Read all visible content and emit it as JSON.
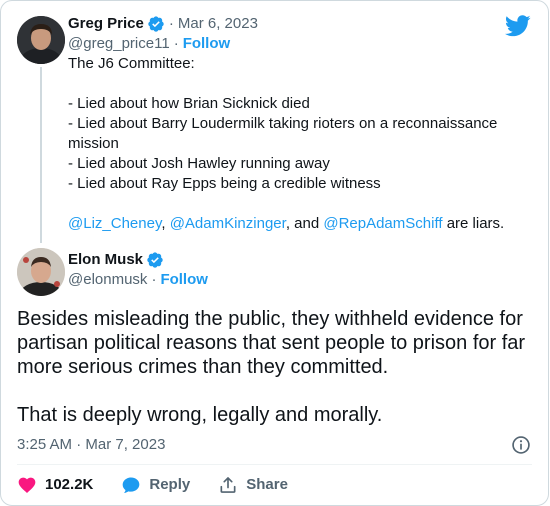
{
  "quoted_tweet": {
    "author_name": "Greg Price",
    "handle": "@greg_price11",
    "date": "Mar 6, 2023",
    "follow_label": "Follow",
    "lines": [
      "The J6 Committee:",
      "",
      "- Lied about how Brian Sicknick died",
      "- Lied about Barry Loudermilk taking rioters on a reconnaissance",
      "mission",
      "- Lied about Josh Hawley running away",
      "- Lied about Ray Epps being a credible witness",
      ""
    ],
    "mentions_line": {
      "mention_1": "@Liz_Cheney",
      "sep_1": ", ",
      "mention_2": "@AdamKinzinger",
      "sep_2": ", and ",
      "mention_3": "@RepAdamSchiff",
      "tail": " are liars."
    }
  },
  "main_tweet": {
    "author_name": "Elon Musk",
    "handle": "@elonmusk",
    "follow_label": "Follow",
    "paragraph_1": "Besides misleading the public, they withheld evidence for partisan political reasons that sent people to prison for far more serious crimes than they committed.",
    "paragraph_2": "That is deeply wrong, legally and morally.",
    "timestamp": "3:25 AM · Mar 7, 2023"
  },
  "actions": {
    "like_count": "102.2K",
    "reply_label": "Reply",
    "share_label": "Share"
  },
  "icons": {
    "twitter_logo": "twitter-bird-icon",
    "verified": "verified-badge-icon",
    "info": "info-icon",
    "like": "heart-icon",
    "reply": "chat-bubble-icon",
    "share": "share-icon"
  },
  "colors": {
    "accent": "#1d9bf0",
    "like": "#f91880",
    "text": "#0f1419",
    "secondary": "#536471"
  }
}
